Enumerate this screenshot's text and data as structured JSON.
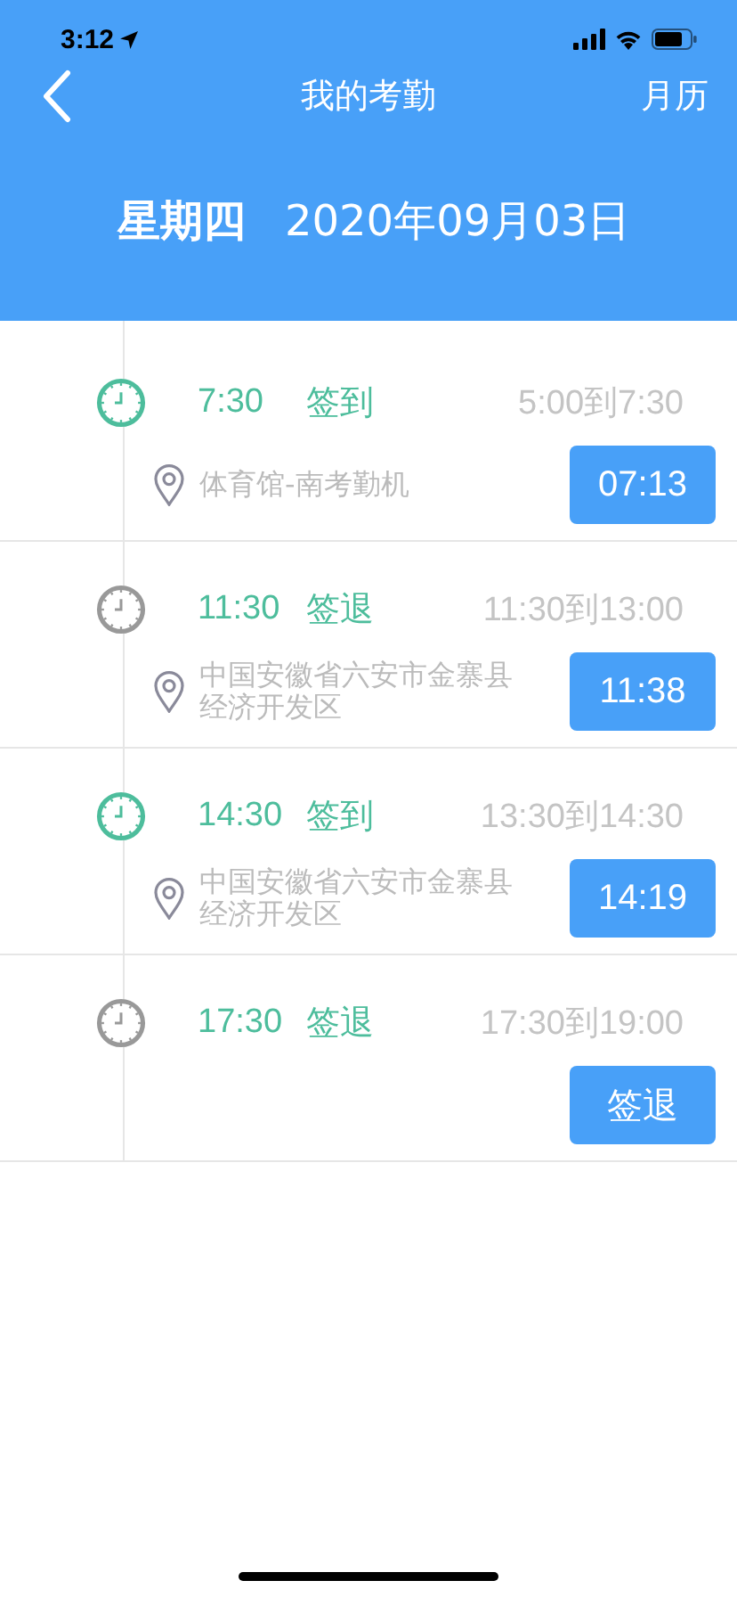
{
  "status_bar": {
    "time": "3:12"
  },
  "nav": {
    "title": "我的考勤",
    "action": "月历"
  },
  "date": {
    "weekday": "星期四",
    "date": "2020年09月03日"
  },
  "records": [
    {
      "kind": "sign_in",
      "time": "7:30",
      "label": "签到",
      "range": "5:00到7:30",
      "location": "体育馆-南考勤机",
      "button": "07:13"
    },
    {
      "kind": "sign_out",
      "time": "11:30",
      "label": "签退",
      "range": "11:30到13:00",
      "location": "中国安徽省六安市金寨县经济开发区",
      "button": "11:38"
    },
    {
      "kind": "sign_in",
      "time": "14:30",
      "label": "签到",
      "range": "13:30到14:30",
      "location": "中国安徽省六安市金寨县经济开发区",
      "button": "14:19"
    },
    {
      "kind": "sign_out",
      "time": "17:30",
      "label": "签退",
      "range": "17:30到19:00",
      "button": "签退"
    }
  ]
}
